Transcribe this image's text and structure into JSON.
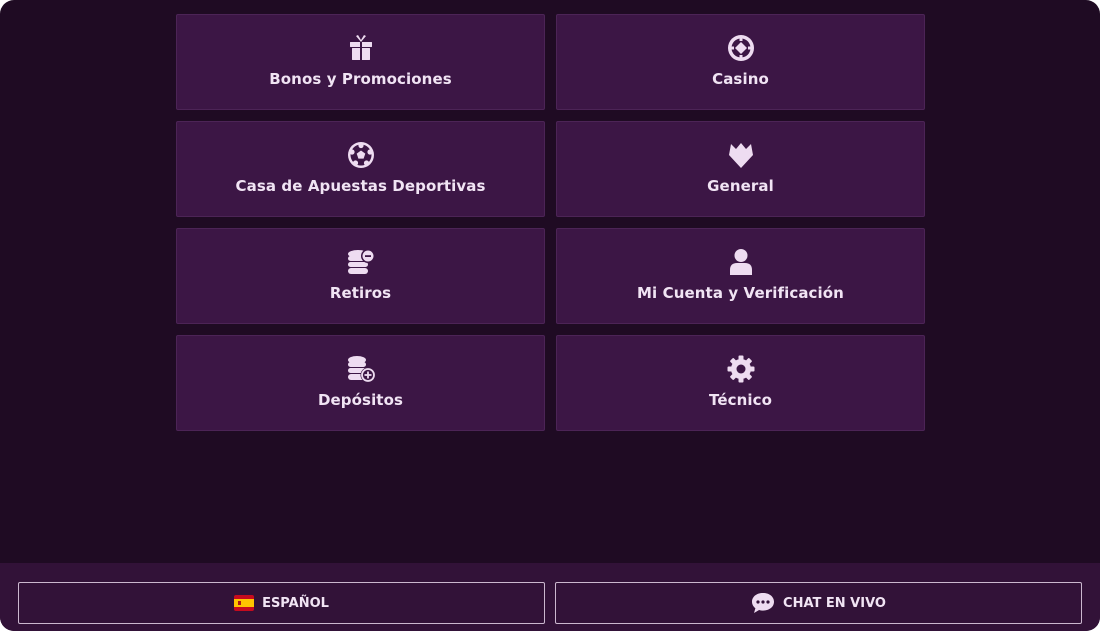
{
  "colors": {
    "background": "#1f0b23",
    "card": "#3c1645",
    "footer": "#321238",
    "text": "#f1e4f4",
    "icon": "#eedcf1"
  },
  "categories": [
    {
      "label": "Bonos y Promociones",
      "icon": "gift-icon"
    },
    {
      "label": "Casino",
      "icon": "casino-chip-icon"
    },
    {
      "label": "Casa de Apuestas Deportivas",
      "icon": "soccer-ball-icon"
    },
    {
      "label": "General",
      "icon": "diamond-crest-icon"
    },
    {
      "label": "Retiros",
      "icon": "coins-minus-icon"
    },
    {
      "label": "Mi Cuenta y Verificación",
      "icon": "user-icon"
    },
    {
      "label": "Depósitos",
      "icon": "coins-plus-icon"
    },
    {
      "label": "Técnico",
      "icon": "gear-icon"
    }
  ],
  "footer": {
    "language_label": "ESPAÑOL",
    "language_icon": "spain-flag-icon",
    "chat_label": "CHAT EN VIVO",
    "chat_icon": "chat-bubble-icon"
  }
}
